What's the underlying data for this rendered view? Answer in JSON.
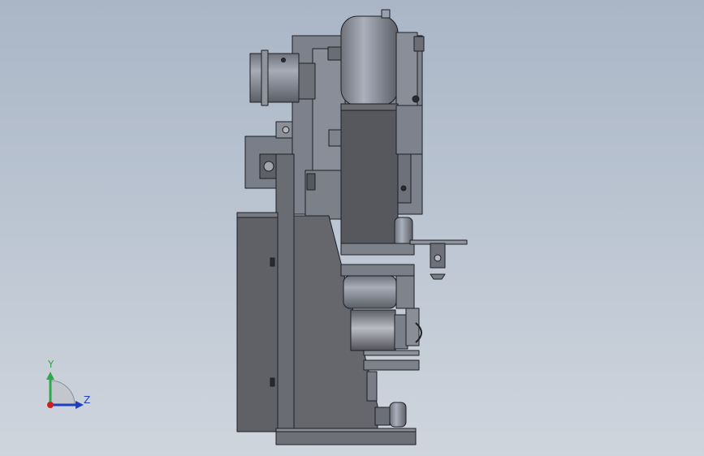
{
  "triad": {
    "y_label": "Y",
    "z_label": "Z",
    "y_color": "#2fa84a",
    "z_color": "#1f3fbf",
    "x_color": "#cc1f1f"
  },
  "colors": {
    "background_top": "#aab6c6",
    "background_bottom": "#cfd5dd",
    "metal_dark": "#5e6066",
    "metal_mid": "#7c7f88",
    "metal_light": "#9aa0ad",
    "edge": "#1e1f24"
  }
}
